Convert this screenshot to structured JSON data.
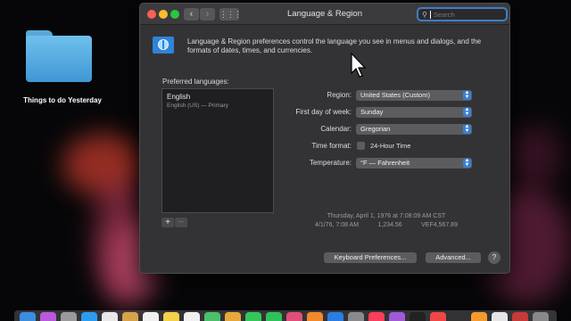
{
  "desktop": {
    "folder_label": "Things to do Yesterday"
  },
  "window": {
    "title": "Language & Region",
    "search_placeholder": "Search",
    "description": "Language & Region preferences control the language you see in menus and dialogs, and the formats of dates, times, and currencies.",
    "nav": {
      "back": "‹",
      "forward": "›",
      "grid": "⋮⋮⋮"
    }
  },
  "languages": {
    "label": "Preferred languages:",
    "items": [
      {
        "name": "English",
        "sub": "English (US) — Primary"
      }
    ],
    "add": "+",
    "remove": "−"
  },
  "settings": {
    "region": {
      "label": "Region:",
      "value": "United States (Custom)"
    },
    "first_day": {
      "label": "First day of week:",
      "value": "Sunday"
    },
    "calendar": {
      "label": "Calendar:",
      "value": "Gregorian"
    },
    "time_format": {
      "label": "Time format:",
      "option": "24-Hour Time",
      "checked": false
    },
    "temperature": {
      "label": "Temperature:",
      "value": "°F — Fahrenheit"
    }
  },
  "sample": {
    "line1": "Thursday, April 1, 1976 at 7:08:09 AM CST",
    "date_short": "4/1/76, 7:08 AM",
    "number": "1,234.56",
    "currency": "VEF4,567.89"
  },
  "buttons": {
    "keyboard": "Keyboard Preferences...",
    "advanced": "Advanced...",
    "help": "?"
  },
  "colors": {
    "accent": "#3a7fd3",
    "window_bg": "#333336"
  },
  "dock_icons": [
    "finder",
    "siri",
    "launchpad",
    "safari",
    "mail",
    "contacts",
    "calendar",
    "notes",
    "reminders",
    "maps",
    "photos",
    "messages",
    "facetime",
    "itunes",
    "ibooks",
    "appstore",
    "preferences",
    "music",
    "podcasts",
    "tv",
    "news",
    "stocks",
    "home",
    "voice-memos",
    "photo-booth",
    "trash"
  ]
}
